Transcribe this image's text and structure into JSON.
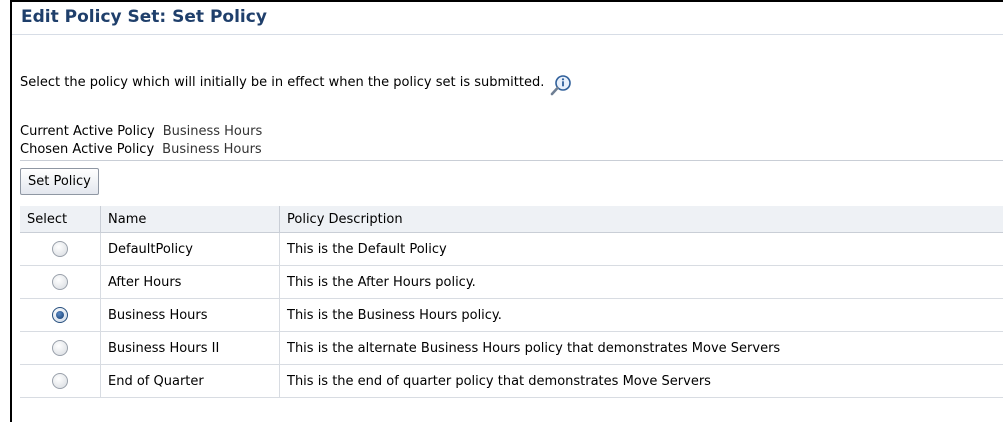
{
  "page": {
    "title": "Edit Policy Set: Set Policy",
    "instruction": "Select the policy which will initially be in effect when the policy set is submitted.",
    "info_icon": "info-magnifier-icon"
  },
  "fields": {
    "current_label": "Current Active Policy",
    "current_value": "Business Hours",
    "chosen_label": "Chosen Active Policy",
    "chosen_value": "Business Hours"
  },
  "toolbar": {
    "set_policy_label": "Set Policy"
  },
  "table": {
    "headers": [
      "Select",
      "Name",
      "Policy Description"
    ],
    "rows": [
      {
        "name": "DefaultPolicy",
        "description": "This is the Default Policy",
        "selected": false
      },
      {
        "name": "After Hours",
        "description": "This is the After Hours policy.",
        "selected": false
      },
      {
        "name": "Business Hours",
        "description": "This is the Business Hours policy.",
        "selected": true
      },
      {
        "name": "Business Hours II",
        "description": "This is the alternate Business Hours policy that demonstrates Move Servers",
        "selected": false
      },
      {
        "name": "End of Quarter",
        "description": "This is the end of quarter policy that demonstrates Move Servers",
        "selected": false
      }
    ]
  },
  "colors": {
    "title": "#1f3f6b",
    "header_bg": "#eef1f5",
    "radio_selected": "#123a6e"
  }
}
